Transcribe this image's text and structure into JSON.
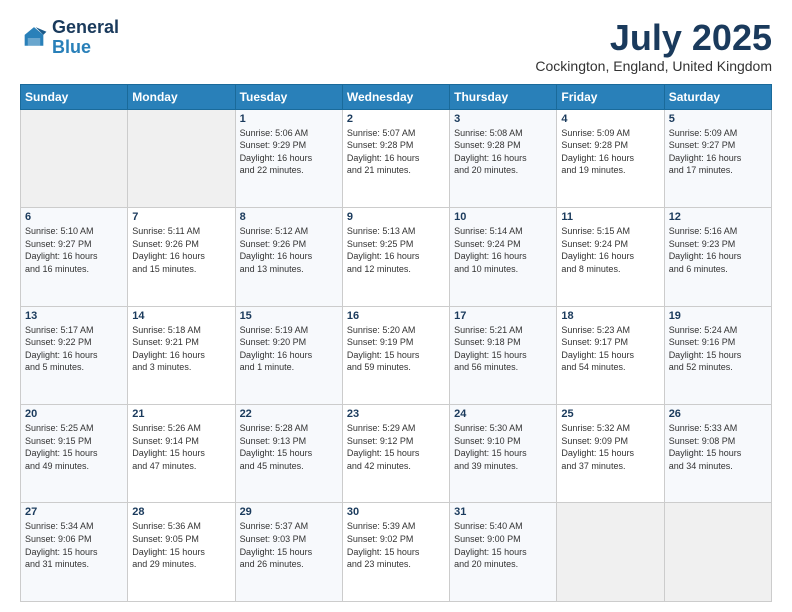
{
  "header": {
    "logo_line1": "General",
    "logo_line2": "Blue",
    "month_title": "July 2025",
    "subtitle": "Cockington, England, United Kingdom"
  },
  "weekdays": [
    "Sunday",
    "Monday",
    "Tuesday",
    "Wednesday",
    "Thursday",
    "Friday",
    "Saturday"
  ],
  "weeks": [
    [
      {
        "num": "",
        "info": ""
      },
      {
        "num": "",
        "info": ""
      },
      {
        "num": "1",
        "info": "Sunrise: 5:06 AM\nSunset: 9:29 PM\nDaylight: 16 hours\nand 22 minutes."
      },
      {
        "num": "2",
        "info": "Sunrise: 5:07 AM\nSunset: 9:28 PM\nDaylight: 16 hours\nand 21 minutes."
      },
      {
        "num": "3",
        "info": "Sunrise: 5:08 AM\nSunset: 9:28 PM\nDaylight: 16 hours\nand 20 minutes."
      },
      {
        "num": "4",
        "info": "Sunrise: 5:09 AM\nSunset: 9:28 PM\nDaylight: 16 hours\nand 19 minutes."
      },
      {
        "num": "5",
        "info": "Sunrise: 5:09 AM\nSunset: 9:27 PM\nDaylight: 16 hours\nand 17 minutes."
      }
    ],
    [
      {
        "num": "6",
        "info": "Sunrise: 5:10 AM\nSunset: 9:27 PM\nDaylight: 16 hours\nand 16 minutes."
      },
      {
        "num": "7",
        "info": "Sunrise: 5:11 AM\nSunset: 9:26 PM\nDaylight: 16 hours\nand 15 minutes."
      },
      {
        "num": "8",
        "info": "Sunrise: 5:12 AM\nSunset: 9:26 PM\nDaylight: 16 hours\nand 13 minutes."
      },
      {
        "num": "9",
        "info": "Sunrise: 5:13 AM\nSunset: 9:25 PM\nDaylight: 16 hours\nand 12 minutes."
      },
      {
        "num": "10",
        "info": "Sunrise: 5:14 AM\nSunset: 9:24 PM\nDaylight: 16 hours\nand 10 minutes."
      },
      {
        "num": "11",
        "info": "Sunrise: 5:15 AM\nSunset: 9:24 PM\nDaylight: 16 hours\nand 8 minutes."
      },
      {
        "num": "12",
        "info": "Sunrise: 5:16 AM\nSunset: 9:23 PM\nDaylight: 16 hours\nand 6 minutes."
      }
    ],
    [
      {
        "num": "13",
        "info": "Sunrise: 5:17 AM\nSunset: 9:22 PM\nDaylight: 16 hours\nand 5 minutes."
      },
      {
        "num": "14",
        "info": "Sunrise: 5:18 AM\nSunset: 9:21 PM\nDaylight: 16 hours\nand 3 minutes."
      },
      {
        "num": "15",
        "info": "Sunrise: 5:19 AM\nSunset: 9:20 PM\nDaylight: 16 hours\nand 1 minute."
      },
      {
        "num": "16",
        "info": "Sunrise: 5:20 AM\nSunset: 9:19 PM\nDaylight: 15 hours\nand 59 minutes."
      },
      {
        "num": "17",
        "info": "Sunrise: 5:21 AM\nSunset: 9:18 PM\nDaylight: 15 hours\nand 56 minutes."
      },
      {
        "num": "18",
        "info": "Sunrise: 5:23 AM\nSunset: 9:17 PM\nDaylight: 15 hours\nand 54 minutes."
      },
      {
        "num": "19",
        "info": "Sunrise: 5:24 AM\nSunset: 9:16 PM\nDaylight: 15 hours\nand 52 minutes."
      }
    ],
    [
      {
        "num": "20",
        "info": "Sunrise: 5:25 AM\nSunset: 9:15 PM\nDaylight: 15 hours\nand 49 minutes."
      },
      {
        "num": "21",
        "info": "Sunrise: 5:26 AM\nSunset: 9:14 PM\nDaylight: 15 hours\nand 47 minutes."
      },
      {
        "num": "22",
        "info": "Sunrise: 5:28 AM\nSunset: 9:13 PM\nDaylight: 15 hours\nand 45 minutes."
      },
      {
        "num": "23",
        "info": "Sunrise: 5:29 AM\nSunset: 9:12 PM\nDaylight: 15 hours\nand 42 minutes."
      },
      {
        "num": "24",
        "info": "Sunrise: 5:30 AM\nSunset: 9:10 PM\nDaylight: 15 hours\nand 39 minutes."
      },
      {
        "num": "25",
        "info": "Sunrise: 5:32 AM\nSunset: 9:09 PM\nDaylight: 15 hours\nand 37 minutes."
      },
      {
        "num": "26",
        "info": "Sunrise: 5:33 AM\nSunset: 9:08 PM\nDaylight: 15 hours\nand 34 minutes."
      }
    ],
    [
      {
        "num": "27",
        "info": "Sunrise: 5:34 AM\nSunset: 9:06 PM\nDaylight: 15 hours\nand 31 minutes."
      },
      {
        "num": "28",
        "info": "Sunrise: 5:36 AM\nSunset: 9:05 PM\nDaylight: 15 hours\nand 29 minutes."
      },
      {
        "num": "29",
        "info": "Sunrise: 5:37 AM\nSunset: 9:03 PM\nDaylight: 15 hours\nand 26 minutes."
      },
      {
        "num": "30",
        "info": "Sunrise: 5:39 AM\nSunset: 9:02 PM\nDaylight: 15 hours\nand 23 minutes."
      },
      {
        "num": "31",
        "info": "Sunrise: 5:40 AM\nSunset: 9:00 PM\nDaylight: 15 hours\nand 20 minutes."
      },
      {
        "num": "",
        "info": ""
      },
      {
        "num": "",
        "info": ""
      }
    ]
  ]
}
